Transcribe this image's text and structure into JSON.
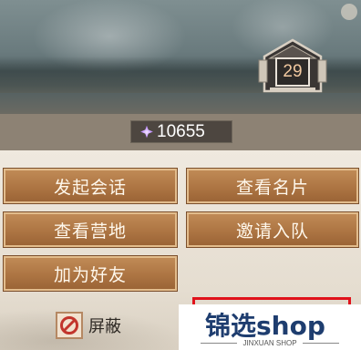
{
  "rank_badge": {
    "level": "29"
  },
  "currency": {
    "icon": "purple-gem-icon",
    "value": "10655"
  },
  "actions": {
    "start_chat": "发起会话",
    "view_card": "查看名片",
    "view_camp": "查看营地",
    "invite_team": "邀请入队",
    "add_friend": "加为好友"
  },
  "block": {
    "icon": "prohibited-icon",
    "label": "屏蔽"
  },
  "watermark": {
    "logo": "锦选shop",
    "sub": "JINXUAN SHOP"
  },
  "colors": {
    "button": "#ad7543",
    "button_border": "#e2bc8c",
    "highlight_frame": "#e0121b",
    "info_bar": "#8d8274"
  }
}
